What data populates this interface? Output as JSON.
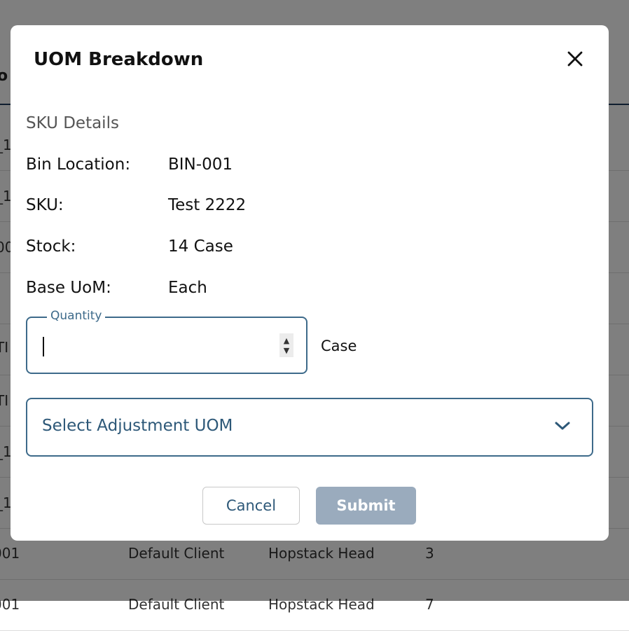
{
  "background": {
    "header_fragment": "o",
    "rows": [
      {
        "c0": "_1"
      },
      {
        "c0": "_1"
      },
      {
        "c0": "00"
      },
      {
        "c0": ""
      },
      {
        "c0": "TI"
      },
      {
        "c0": "TI"
      },
      {
        "c0": "_1"
      },
      {
        "c0": "_1"
      },
      {
        "c0": "001",
        "client": "Default Client",
        "owner": "Hopstack Head",
        "qty": "3"
      },
      {
        "c0": "001",
        "client": "Default Client",
        "owner": "Hopstack Head",
        "qty": "7"
      }
    ]
  },
  "modal": {
    "title": "UOM Breakdown",
    "close_icon": "close-icon",
    "section_title": "SKU Details",
    "details": [
      {
        "label": "Bin Location:",
        "value": "BIN-001"
      },
      {
        "label": "SKU:",
        "value": "Test 2222"
      },
      {
        "label": "Stock:",
        "value": "14 Case"
      },
      {
        "label": "Base UoM:",
        "value": "Each"
      }
    ],
    "quantity": {
      "label": "Quantity",
      "value": "",
      "placeholder": "",
      "unit": "Case"
    },
    "uom_select": {
      "placeholder": "Select Adjustment UOM",
      "icon": "chevron-down-icon"
    },
    "cancel_label": "Cancel",
    "submit_label": "Submit"
  },
  "colors": {
    "accent": "#3d6a8a",
    "accent_text": "#2d5878",
    "submit_disabled": "#9aabbd",
    "overlay": "rgba(0,0,0,0.5)"
  }
}
